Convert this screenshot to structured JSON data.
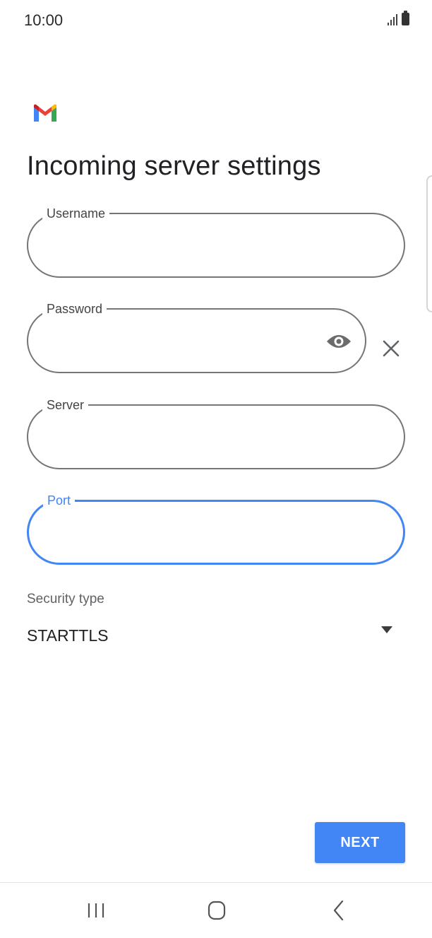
{
  "status_bar": {
    "time": "10:00"
  },
  "page": {
    "title": "Incoming server settings"
  },
  "fields": {
    "username": {
      "label": "Username",
      "value": ""
    },
    "password": {
      "label": "Password",
      "value": ""
    },
    "server": {
      "label": "Server",
      "value": ""
    },
    "port": {
      "label": "Port",
      "value": ""
    }
  },
  "security": {
    "label": "Security type",
    "value": "STARTTLS"
  },
  "actions": {
    "next_label": "NEXT"
  },
  "colors": {
    "accent": "#4285f4",
    "field_border": "#757575",
    "text": "#202124"
  },
  "icons": [
    "gmail-logo",
    "signal-icon",
    "battery-icon",
    "visibility-icon",
    "close-icon",
    "dropdown-arrow-icon",
    "recent-apps-icon",
    "home-icon",
    "back-icon"
  ]
}
